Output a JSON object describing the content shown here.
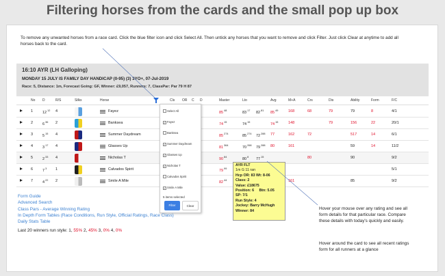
{
  "page_title": "Filtering horses from the cards and the small pop up box",
  "instructions": "To remove any unwanted horses from a race card. Click the blue filter icon and click Select All. Then untick any horses that you want to remove and click Filter. Just click Clear at anytime to add all horses back to the card.",
  "race": {
    "title": "16:10 AYR (LH Galloping)",
    "subtitle": "MONDAY 15 JULY IS FAMILY DAY HANDICAP (0-95) (3) 3YO+, 07-Jul-2019",
    "details": "Race: 5,  Distance: 1m,  Forecast Going: GF,  Winner: £9,057,  Runners: 7,  ClassPar: Par 79 H 87"
  },
  "columns": [
    "No",
    "D",
    "R/S",
    "Silks",
    "Horse",
    "Cls",
    "OR",
    "C",
    "D",
    "Master",
    "Lto",
    "Avg",
    "M+A",
    "Crs",
    "Dis",
    "Ability",
    "Form",
    "F/C"
  ],
  "rows": [
    {
      "no": "1",
      "d": "12",
      "dsup": "12",
      "rs": "4",
      "horse": "Fayez",
      "master": "85",
      "mastersup": "48",
      "lto": "83",
      "ltosup": "17",
      "avgA": "82",
      "avgAsup": "81",
      "avg": "85",
      "avgsup": "49",
      "ma": "168",
      "crs": "68",
      "dis": "79",
      "ability": "79",
      "form": "8",
      "fc": "4/1",
      "silk": [
        "#f5f5f5",
        "#5aa0e0"
      ]
    },
    {
      "no": "2",
      "d": "6",
      "dsup": "36",
      "rs": "2",
      "horse": "Banksea",
      "master": "74",
      "mastersup": "15",
      "lto": "74",
      "ltosup": "15",
      "avgA": "",
      "avgAsup": "",
      "avg": "74",
      "avgsup": "15",
      "ma": "148",
      "crs": "",
      "dis": "79",
      "ability": "156",
      "form": "22",
      "fc": "20/1",
      "silk": [
        "#2aa0d8",
        "#f0d020"
      ]
    },
    {
      "no": "3",
      "d": "5",
      "dsup": "15",
      "rs": "4",
      "horse": "Summer Daydream",
      "master": "85",
      "mastersup": "274",
      "lto": "85",
      "ltosup": "274",
      "avgA": "72",
      "avgAsup": "288",
      "avg": "77",
      "avgsup": "",
      "ma": "162",
      "crs": "72",
      "dis": "",
      "ability": "517",
      "form": "14",
      "fc": "6/1",
      "silk": [
        "#c01818",
        "#1a2a80"
      ]
    },
    {
      "no": "4",
      "d": "3",
      "dsup": "17",
      "rs": "4",
      "horse": "Glasses Up",
      "master": "81",
      "mastersup": "364",
      "lto": "70",
      "ltosup": "268",
      "avgA": "79",
      "avgAsup": "288",
      "avg": "80",
      "avgsup": "",
      "ma": "161",
      "crs": "",
      "dis": "",
      "ability": "59",
      "form": "14",
      "fc": "11/2",
      "silk": [
        "#1a2a80",
        "#c01818"
      ]
    },
    {
      "no": "5",
      "d": "2",
      "dsup": "33",
      "rs": "4",
      "horse": "Nicholas T",
      "master": "90",
      "mastersup": "84",
      "lto": "80",
      "ltosup": "8",
      "avgA": "77",
      "avgAsup": "15",
      "avg": "",
      "avgsup": "",
      "ma": "",
      "crs": "80",
      "dis": "",
      "ability": "90",
      "form": "",
      "fc": "9/2",
      "silk": [
        "#c01818",
        "#f5f5f5"
      ]
    },
    {
      "no": "6",
      "d": "7",
      "dsup": "3",
      "rs": "1",
      "horse": "Calvados Spirit",
      "master": "79",
      "mastersup": "99",
      "lto": "82",
      "ltosup": "10",
      "avgA": "",
      "avgAsup": "",
      "avg": "",
      "avgsup": "",
      "ma": "",
      "crs": "",
      "dis": "",
      "ability": "",
      "form": "",
      "fc": "5/1",
      "silk": [
        "#202020",
        "#f0d020"
      ]
    },
    {
      "no": "7",
      "d": "4",
      "dsup": "22",
      "rs": "2",
      "horse": "Smile A Mile",
      "master": "82",
      "mastersup": "44",
      "lto": "",
      "ltosup": "",
      "avgA": "",
      "avgAsup": "",
      "avg": "",
      "avgsup": "",
      "ma": "161",
      "crs": "",
      "dis": "",
      "ability": "85",
      "form": "",
      "fc": "9/2",
      "silk": [
        "#f0f0f0",
        "#bbbbbb"
      ]
    }
  ],
  "filter_popup": {
    "items": [
      {
        "label": "Select All",
        "checked": false
      },
      {
        "label": "Fayez",
        "checked": true
      },
      {
        "label": "Banksea",
        "checked": false
      },
      {
        "label": "Summer Daydream",
        "checked": true
      },
      {
        "label": "Glasses Up",
        "checked": true
      },
      {
        "label": "Nicholas T",
        "checked": true
      },
      {
        "label": "Calvados Spirit",
        "checked": false
      },
      {
        "label": "Smile A Mile",
        "checked": true
      }
    ],
    "selected_text": "5 items selected",
    "filter_label": "Filter",
    "clear_label": "Clear"
  },
  "tooltip": {
    "line1": "AYR    FLT",
    "line2": "1m  G   11 ran",
    "hcp": "Hcp    OR: 83      Wt: 8-06",
    "class": "Class: 2",
    "value": "Value: £18675",
    "position": "Position: 6",
    "btn": "Btn: 5.05",
    "sp": "SP: 7/1",
    "run_style": "Run Style: 4",
    "jockey": "Jockey: Barry McHugh",
    "winner": "Winner: 84"
  },
  "hover_text_1": "Hover your mouse over any rating and see all form details for that particular race. Compare these details with today's quickly and easily.",
  "hover_text_2": "Hover around the card to see all recent ratings form for all runners at a glance",
  "links": [
    "Form Guide",
    "Advanced Search",
    "Class Pars - Average Winning Rating",
    "In Depth Form Tables (Race Conditions, Run Style, Official Ratings, Race Class)",
    "Daily Stats Table"
  ],
  "last20": {
    "prefix": "Last 20 winners run style: ",
    "values": [
      [
        "1",
        "#222"
      ],
      [
        ", ",
        ""
      ],
      [
        "55%",
        "#e0102a"
      ],
      [
        " 2, ",
        ""
      ],
      [
        "45%",
        "#e0102a"
      ],
      [
        " 3, ",
        ""
      ],
      [
        "0%",
        "#e0102a"
      ],
      [
        " 4, ",
        ""
      ],
      [
        "0%",
        "#e0102a"
      ]
    ]
  }
}
